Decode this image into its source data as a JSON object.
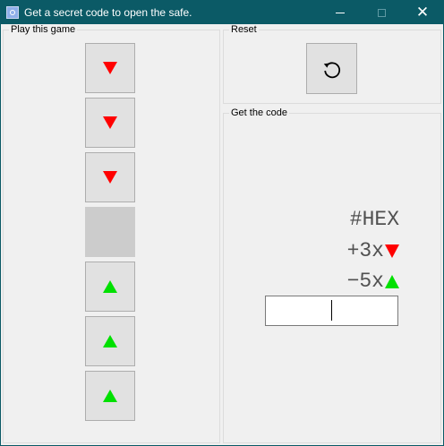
{
  "window": {
    "title": "Get a secret code to open the safe.",
    "app_icon": "safe-icon",
    "controls": {
      "minimize": "minimize-icon",
      "maximize": "maximize-icon",
      "close": "✕"
    }
  },
  "play_group": {
    "label": "Play this game",
    "tiles": [
      {
        "state": "down",
        "icon": "red-down-triangle-icon",
        "color": "#ff0000"
      },
      {
        "state": "down",
        "icon": "red-down-triangle-icon",
        "color": "#ff0000"
      },
      {
        "state": "down",
        "icon": "red-down-triangle-icon",
        "color": "#ff0000"
      },
      {
        "state": "empty",
        "icon": "",
        "color": "#cccccc"
      },
      {
        "state": "up",
        "icon": "green-up-triangle-icon",
        "color": "#00e000"
      },
      {
        "state": "up",
        "icon": "green-up-triangle-icon",
        "color": "#00e000"
      },
      {
        "state": "up",
        "icon": "green-up-triangle-icon",
        "color": "#00e000"
      }
    ]
  },
  "reset_group": {
    "label": "Reset",
    "button_icon": "reset-arrow-icon"
  },
  "code_group": {
    "label": "Get the code",
    "hint_hex": "#HEX",
    "hint_plus": "+3x",
    "hint_plus_icon": "red-down-triangle-icon",
    "hint_minus": "−5x",
    "hint_minus_icon": "green-up-triangle-icon",
    "input_value": ""
  }
}
